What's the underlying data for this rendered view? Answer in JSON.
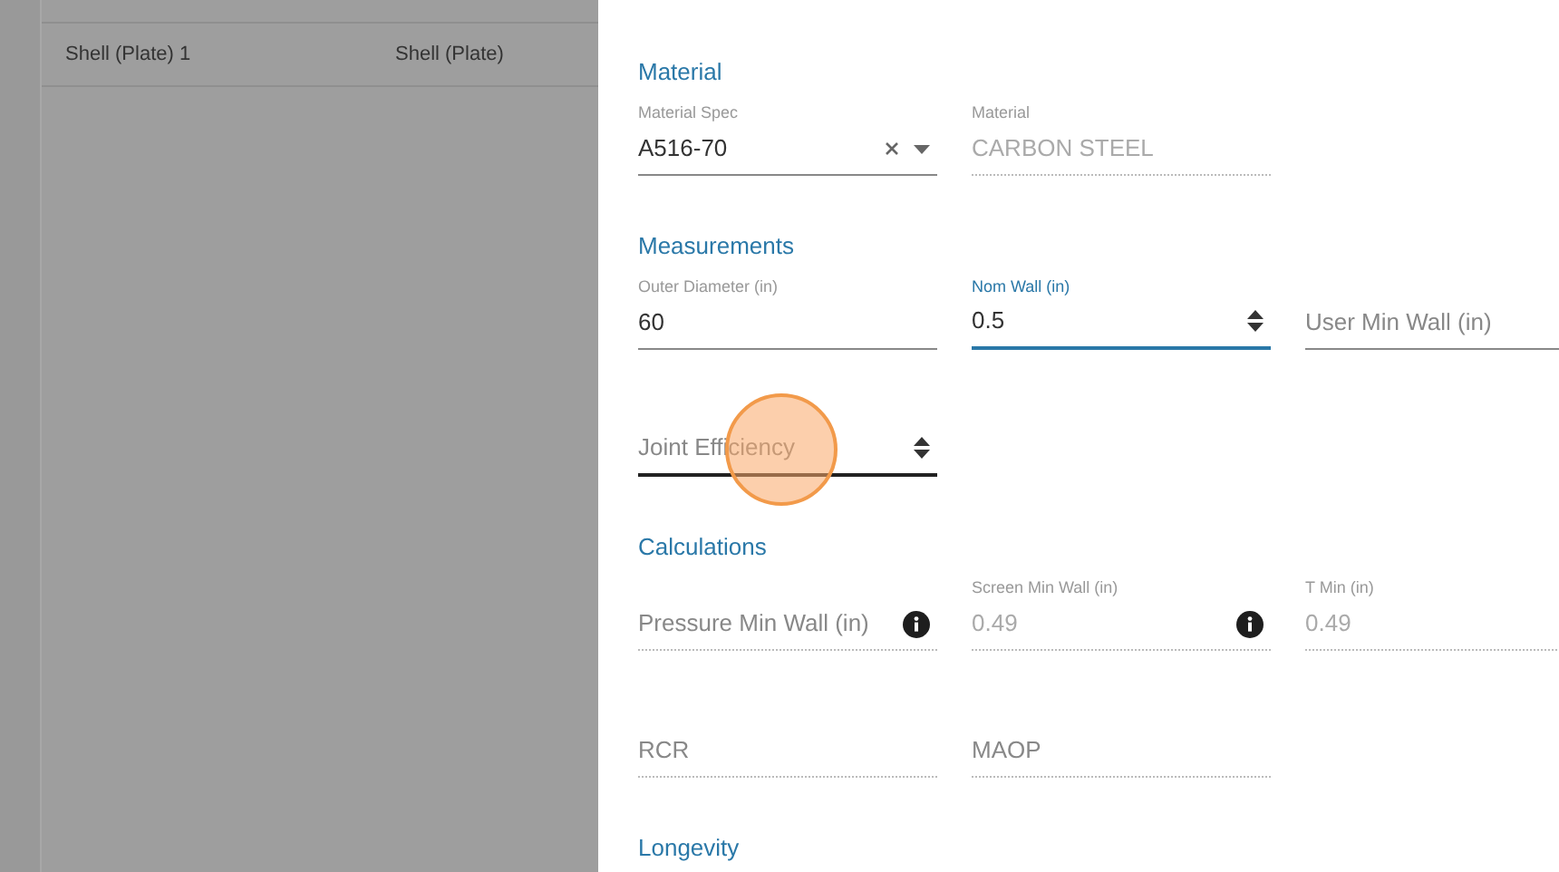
{
  "table": {
    "rows": [
      {
        "cells": [
          "Shell (Plate) 1",
          "Shell (Plate)"
        ]
      }
    ]
  },
  "sections": [
    {
      "title": "Material",
      "rows": [
        [
          {
            "kind": "select",
            "label": "Material Spec",
            "value": "A516-70",
            "focused": false
          },
          {
            "kind": "readonly",
            "label": "Material",
            "value": "CARBON STEEL"
          }
        ]
      ]
    },
    {
      "title": "Measurements",
      "rows": [
        [
          {
            "kind": "text",
            "label": "Outer Diameter (in)",
            "value": "60",
            "focused": false
          },
          {
            "kind": "number",
            "label": "Nom Wall (in)",
            "value": "0.5",
            "focused": true
          },
          {
            "kind": "text",
            "placeholder": "User Min Wall (in)",
            "focused": false
          }
        ],
        [
          {
            "kind": "number",
            "placeholder": "Joint Efficiency",
            "focused": false,
            "hovered": true,
            "click_marker": true
          }
        ]
      ]
    },
    {
      "title": "Calculations",
      "rows": [
        [
          {
            "kind": "readonly",
            "placeholder": "Pressure Min Wall (in)",
            "info": true
          },
          {
            "kind": "readonly",
            "label": "Screen Min Wall (in)",
            "value": "0.49",
            "info": true
          },
          {
            "kind": "readonly",
            "label": "T Min (in)",
            "value": "0.49"
          }
        ],
        [
          {
            "kind": "readonly",
            "placeholder": "RCR"
          },
          {
            "kind": "readonly",
            "placeholder": "MAOP"
          }
        ]
      ]
    },
    {
      "title": "Longevity"
    }
  ]
}
